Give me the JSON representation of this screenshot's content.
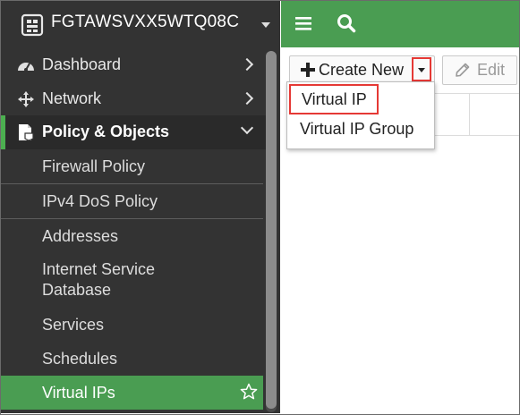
{
  "sidebar": {
    "device_name": "FGTAWSVXX5WTQ08C",
    "items": [
      {
        "label": "Dashboard"
      },
      {
        "label": "Network"
      },
      {
        "label": "Policy & Objects"
      }
    ],
    "subitems": [
      {
        "label": "Firewall Policy"
      },
      {
        "label": "IPv4 DoS Policy"
      },
      {
        "label": "Addresses"
      },
      {
        "label": "Internet Service Database"
      },
      {
        "label": "Services"
      },
      {
        "label": "Schedules"
      },
      {
        "label": "Virtual IPs"
      }
    ]
  },
  "toolbar": {
    "create_new_label": "Create New",
    "edit_label": "Edit"
  },
  "dropdown": {
    "items": [
      {
        "label": "Virtual IP"
      },
      {
        "label": "Virtual IP Group"
      }
    ]
  },
  "colors": {
    "accent_green": "#4a9d52",
    "sidebar_bg": "#333333",
    "highlight_red": "#e53935"
  },
  "icons": [
    "device-icon",
    "dashboard-icon",
    "network-icon",
    "policy-icon",
    "star-icon",
    "menu-icon",
    "search-icon",
    "plus-icon",
    "pencil-icon"
  ]
}
